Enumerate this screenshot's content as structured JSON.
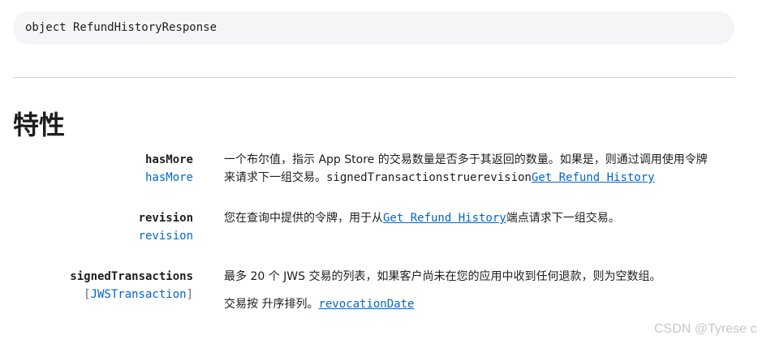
{
  "declaration": "object RefundHistoryResponse",
  "section_title": "特性",
  "properties": [
    {
      "name": "hasMore",
      "type": "hasMore",
      "desc_line1": "一个布尔值，指示 App Store 的交易数量是否多于其返回的数量。如果是，则通过调用使用令牌",
      "desc_line2_text": "来请求下一组交易。",
      "desc_line2_mono": "signedTransactionstruerevision",
      "desc_link": "Get Refund History"
    },
    {
      "name": "revision",
      "type": "revision",
      "desc_before": "您在查询中提供的令牌，用于从",
      "desc_link": "Get Refund History",
      "desc_after": "端点请求下一组交易。"
    },
    {
      "name": "signedTransactions",
      "type_open": "[",
      "type": "JWSTransaction",
      "type_close": "]",
      "desc_p1": "最多 20 个 JWS 交易的列表，如果客户尚未在您的应用中收到任何退款，则为空数组。",
      "desc_p2_before": "交易按 升序排列。",
      "desc_p2_link": "revocationDate"
    }
  ],
  "watermark": "CSDN @Tyrese c"
}
